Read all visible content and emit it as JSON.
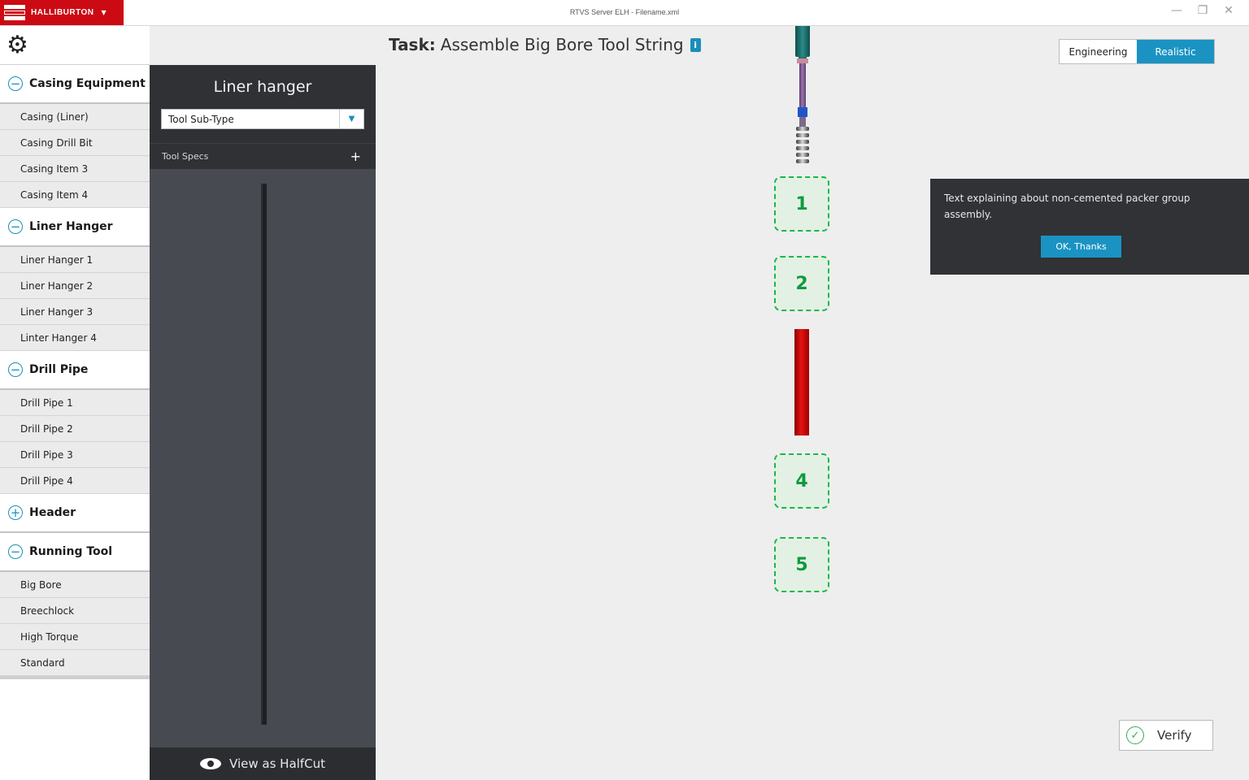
{
  "window": {
    "brand": "HALLIBURTON",
    "brand_caret": "▼",
    "title": "RTVS Server ELH - Filename.xml",
    "controls": {
      "minimize": "—",
      "restore": "❐",
      "close": "✕"
    }
  },
  "sidebar": {
    "settings_icon": "gear-icon",
    "groups": [
      {
        "label": "Casing Equipment",
        "state": "expanded",
        "toggle": "−",
        "items": [
          "Casing (Liner)",
          "Casing Drill Bit",
          "Casing Item 3",
          "Casing Item 4"
        ]
      },
      {
        "label": "Liner Hanger",
        "state": "expanded",
        "toggle": "−",
        "items": [
          "Liner Hanger 1",
          "Liner Hanger 2",
          "Liner Hanger 3",
          "Linter Hanger 4"
        ]
      },
      {
        "label": "Drill Pipe",
        "state": "expanded",
        "toggle": "−",
        "items": [
          "Drill Pipe 1",
          "Drill Pipe 2",
          "Drill Pipe 3",
          "Drill Pipe 4"
        ]
      },
      {
        "label": "Header",
        "state": "collapsed",
        "toggle": "+",
        "items": []
      },
      {
        "label": "Running Tool",
        "state": "expanded",
        "toggle": "−",
        "items": [
          "Big Bore",
          "Breechlock",
          "High Torque",
          "Standard"
        ]
      }
    ]
  },
  "tool_panel": {
    "title": "Liner hanger",
    "subtype_select": {
      "value": "Tool Sub-Type",
      "arrow": "▼"
    },
    "specs_label": "Tool Specs",
    "specs_toggle": "+",
    "footer_label": "View as HalfCut"
  },
  "main": {
    "task_prefix": "Task:",
    "task_name": "Assemble Big Bore Tool String",
    "info_glyph": "i",
    "view_toggle": {
      "engineering": "Engineering",
      "realistic": "Realistic",
      "active": "Realistic"
    },
    "slots": [
      "1",
      "2",
      "4",
      "5"
    ],
    "tooltip": {
      "text": "Text explaining about non-cemented packer group assembly.",
      "button": "OK, Thanks"
    },
    "verify_label": "Verify",
    "verify_glyph": "✓"
  },
  "colors": {
    "brand_red": "#cc0a14",
    "accent_blue": "#1a93c3",
    "slot_green": "#1ab84a",
    "pipe_red": "#e51414"
  }
}
